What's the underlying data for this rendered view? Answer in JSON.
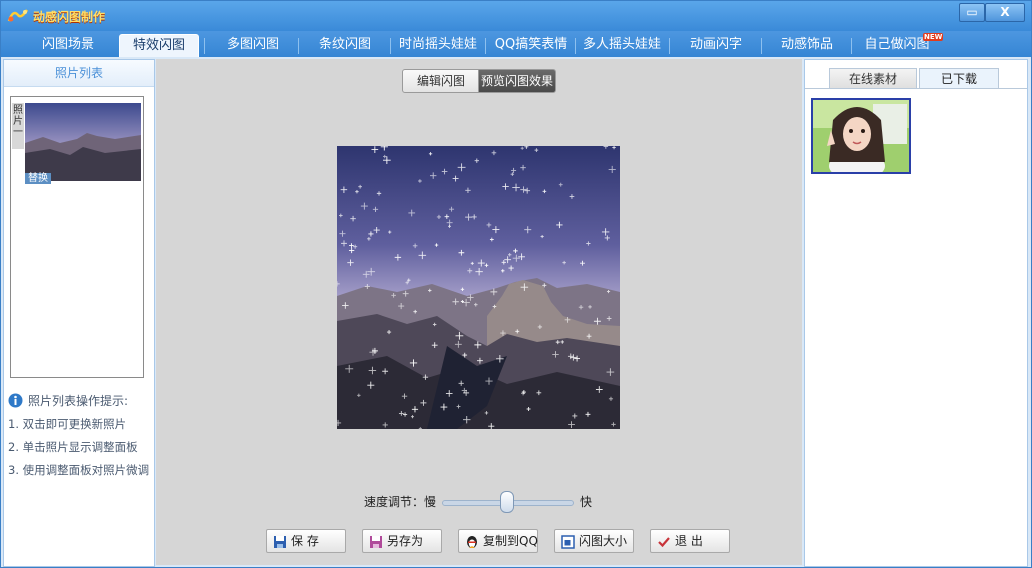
{
  "window": {
    "title": "动感闪图制作",
    "minimize_label": "▭",
    "close_label": "X"
  },
  "tabs": [
    {
      "label": "闪图场景"
    },
    {
      "label": "特效闪图",
      "active": true
    },
    {
      "label": "多图闪图"
    },
    {
      "label": "条纹闪图"
    },
    {
      "label": "时尚摇头娃娃"
    },
    {
      "label": "QQ搞笑表情"
    },
    {
      "label": "多人摇头娃娃"
    },
    {
      "label": "动画闪字"
    },
    {
      "label": "动感饰品"
    },
    {
      "label": "自己做闪图"
    }
  ],
  "new_badge": "NEW",
  "left_panel": {
    "header": "照片列表",
    "photo_tab_label": "照片一",
    "replace_label": "替换",
    "tips_title": "照片列表操作提示:",
    "tips": [
      "1. 双击即可更换新照片",
      "2. 单击照片显示调整面板",
      "3. 使用调整面板对照片微调"
    ]
  },
  "center_panel": {
    "edit_mode_label": "编辑闪图",
    "preview_mode_label": "预览闪图效果",
    "speed_label": "速度调节：慢",
    "speed_fast_label": "快",
    "speed_value": 0.5,
    "buttons": {
      "save": "保  存",
      "save_as": "另存为",
      "copy_to_qq": "复制到QQ",
      "size": "闪图大小",
      "exit": "退  出"
    }
  },
  "right_panel": {
    "tab_online": "在线素材",
    "tab_downloaded": "已下载"
  },
  "colors": {
    "title_bar": "#3a8ad8",
    "active_tab": "#eef5fd",
    "selected_border": "#2a3fa8"
  }
}
